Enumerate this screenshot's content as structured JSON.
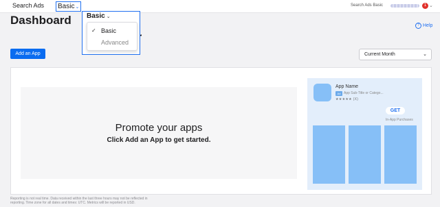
{
  "topbar": {
    "brand": "Search Ads",
    "account_selector": "Basic",
    "product_label": "Search Ads Basic",
    "notification_count": "1"
  },
  "page": {
    "title": "Dashboard",
    "help_label": "Help"
  },
  "dropdown": {
    "selected": "Basic",
    "options": [
      {
        "label": "Basic",
        "checked": true
      },
      {
        "label": "Advanced",
        "checked": false
      }
    ]
  },
  "toolbar": {
    "add_app_label": "Add an App",
    "period_value": "Current Month"
  },
  "promo": {
    "heading": "Promote your apps",
    "subheading": "Click Add an App to get started."
  },
  "preview": {
    "app_name": "App Name",
    "ad_badge": "Ad",
    "subtitle": "App Sub-Title or Catego...",
    "rating_count": "(X)",
    "get_label": "GET",
    "iap_label": "In-App Purchases"
  },
  "footer": {
    "line1": "Reporting is not real time. Data received within the last three hours may not be reflected in",
    "line2": "reporting. Time zone for all dates and times: UTC. Metrics will be reported in USD."
  },
  "colors": {
    "accent": "#0a6cf0",
    "preview_bg": "#e3eefb",
    "placeholder_blue": "#86bff7",
    "badge_red": "#e0302a"
  }
}
